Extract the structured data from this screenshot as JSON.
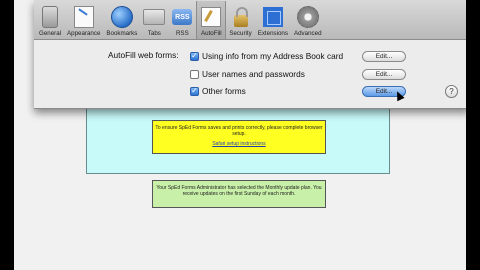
{
  "window": {
    "title": "AutoFill"
  },
  "toolbar": {
    "items": [
      {
        "label": "General",
        "icon": "general-icon"
      },
      {
        "label": "Appearance",
        "icon": "appearance-icon"
      },
      {
        "label": "Bookmarks",
        "icon": "bookmarks-icon"
      },
      {
        "label": "Tabs",
        "icon": "tabs-icon"
      },
      {
        "label": "RSS",
        "icon": "rss-icon",
        "icon_text": "RSS"
      },
      {
        "label": "AutoFill",
        "icon": "autofill-icon",
        "active": true
      },
      {
        "label": "Security",
        "icon": "security-icon"
      },
      {
        "label": "Extensions",
        "icon": "extensions-icon"
      },
      {
        "label": "Advanced",
        "icon": "advanced-icon"
      }
    ]
  },
  "autofill": {
    "section_label": "AutoFill web forms:",
    "options": [
      {
        "label": "Using info from my Address Book card",
        "checked": true,
        "button": "Edit..."
      },
      {
        "label": "User names and passwords",
        "checked": false,
        "button": "Edit..."
      },
      {
        "label": "Other forms",
        "checked": true,
        "button": "Edit..."
      }
    ],
    "help": "?"
  },
  "background_page": {
    "yellow_note": {
      "text": "To ensure SpEd Forms saves and prints correctly, please complete browser setup.",
      "link": "Safari setup instructions"
    },
    "green_note": {
      "text": "Your SpEd Forms Administrator has selected the Monthly update plan. You receive updates on the first Sunday of each month."
    }
  },
  "colors": {
    "accent": "#2d73d2",
    "note_yellow": "#ffff22",
    "note_green": "#c8f0a8",
    "page_cyan": "#c8fafa"
  }
}
